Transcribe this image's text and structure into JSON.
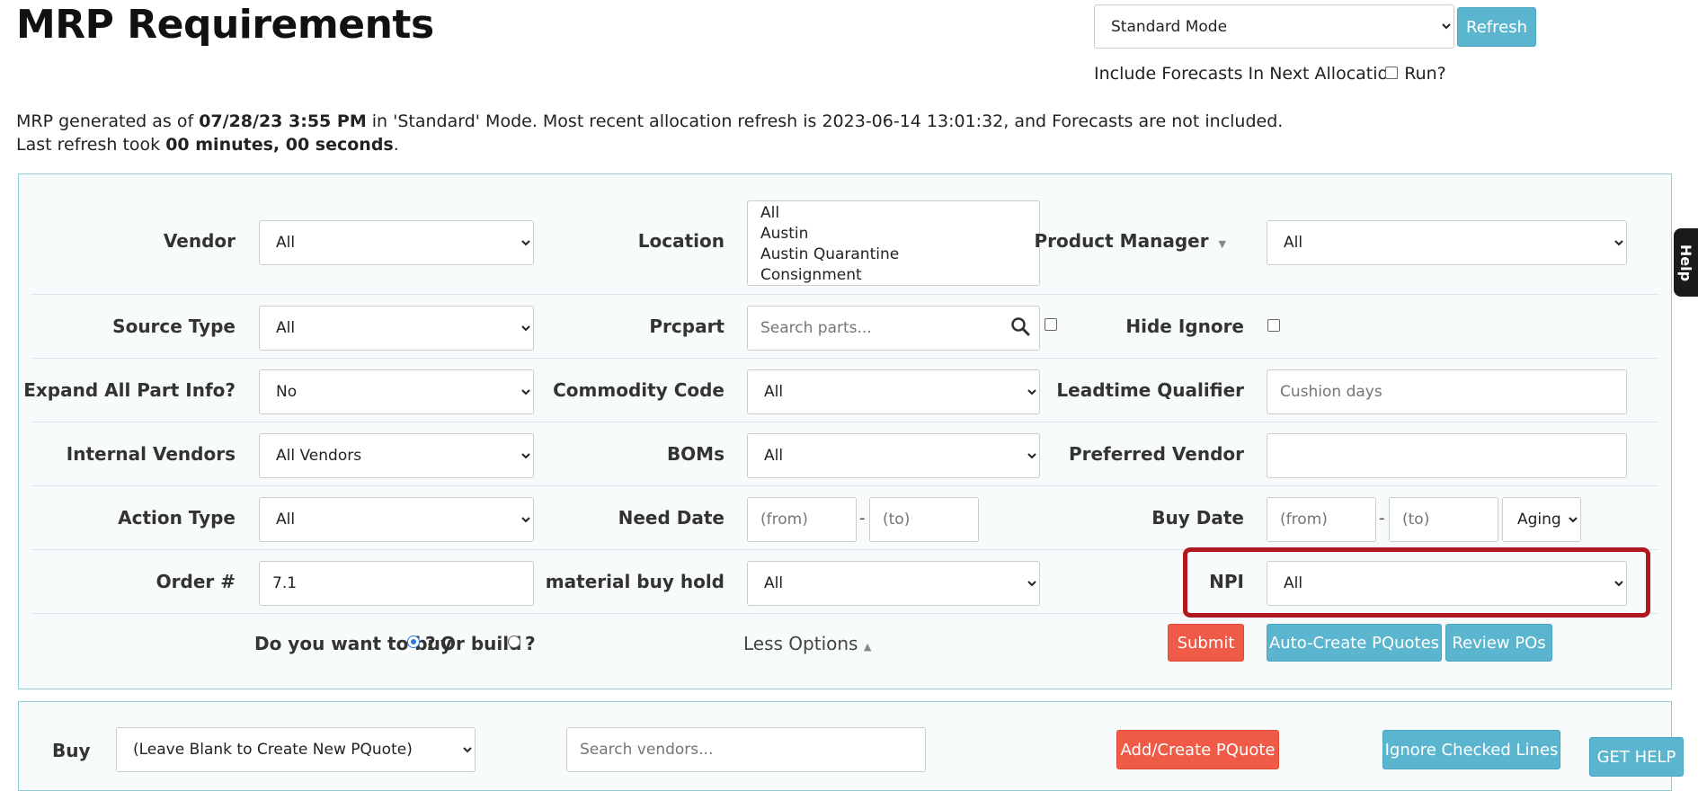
{
  "page": {
    "title": "MRP Requirements"
  },
  "mode": {
    "selected": "Standard Mode",
    "refresh_label": "Refresh",
    "forecast_label": "Include Forecasts In Next Allocation Run?"
  },
  "info": {
    "line1_prefix": "MRP generated as of ",
    "generated_at": "07/28/23 3:55 PM",
    "line1_suffix": " in 'Standard' Mode. Most recent allocation refresh is 2023-06-14 13:01:32, and Forecasts are not included.",
    "line2_prefix": "Last refresh took ",
    "duration": "00 minutes, 00 seconds",
    "line2_suffix": "."
  },
  "filters": {
    "vendor": {
      "label": "Vendor",
      "value": "All"
    },
    "location": {
      "label": "Location",
      "options": [
        "All",
        "Austin",
        "Austin Quarantine",
        "Consignment"
      ]
    },
    "product_manager": {
      "label": "Product Manager",
      "value": "All"
    },
    "source_type": {
      "label": "Source Type",
      "value": "All"
    },
    "prcpart": {
      "label": "Prcpart",
      "placeholder": "Search parts..."
    },
    "hide_ignore": {
      "label": "Hide Ignore"
    },
    "expand_all": {
      "label": "Expand All Part Info?",
      "value": "No"
    },
    "commodity_code": {
      "label": "Commodity Code",
      "value": "All"
    },
    "leadtime_qualifier": {
      "label": "Leadtime Qualifier",
      "placeholder": "Cushion days"
    },
    "internal_vendors": {
      "label": "Internal Vendors",
      "value": "All Vendors"
    },
    "boms": {
      "label": "BOMs",
      "value": "All"
    },
    "preferred_vendor": {
      "label": "Preferred Vendor",
      "value": ""
    },
    "action_type": {
      "label": "Action Type",
      "value": "All"
    },
    "need_date": {
      "label": "Need Date",
      "from_placeholder": "(from)",
      "to_placeholder": "(to)"
    },
    "buy_date": {
      "label": "Buy Date",
      "from_placeholder": "(from)",
      "to_placeholder": "(to)",
      "aging": "Aging"
    },
    "order_num": {
      "label": "Order #",
      "value": "7.1"
    },
    "material_buy_hold": {
      "label": "material buy hold",
      "value": "All"
    },
    "npi": {
      "label": "NPI",
      "value": "All"
    },
    "date_dash": "-"
  },
  "actions": {
    "question_prefix": "Do you want to ",
    "buy_word": "buy",
    "or_text": "Or ",
    "build_word": "build",
    "qmark": "?",
    "less_options": "Less Options",
    "submit": "Submit",
    "auto_create": "Auto-Create PQuotes",
    "review_pos": "Review POs"
  },
  "buy_panel": {
    "label": "Buy",
    "pquote_value": "(Leave Blank to Create New PQuote)",
    "vendor_search_placeholder": "Search vendors...",
    "add_create": "Add/Create PQuote",
    "ignore_checked": "Ignore Checked Lines"
  },
  "help": {
    "tab": "Help",
    "get_help": "GET HELP"
  },
  "colors": {
    "teal": "#5bb5cf",
    "red": "#ef5b47",
    "highlight": "#b01820"
  }
}
